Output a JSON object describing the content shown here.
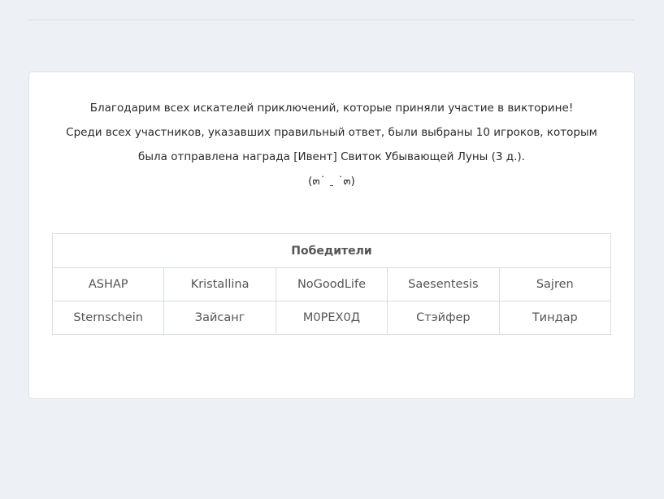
{
  "announcement": {
    "line1": "Благодарим всех искателей приключений, которые приняли участие в викторине!",
    "line2": "Среди всех участников, указавших правильный ответ, были выбраны 10 игроков, которым была отправлена награда [Ивент] Свиток Убывающей Луны (3 д.).",
    "emoticon": "(๓˙ ˍ ˙๓)"
  },
  "winners_table": {
    "header": "Победители",
    "rows": [
      [
        "ASHAP",
        "Kristallina",
        "NoGoodLife",
        "Saesentesis",
        "Sajren"
      ],
      [
        "Sternschein",
        "Зайсанг",
        "М0РЕХ0Д",
        "Стэйфер",
        "Тиндар"
      ]
    ]
  }
}
